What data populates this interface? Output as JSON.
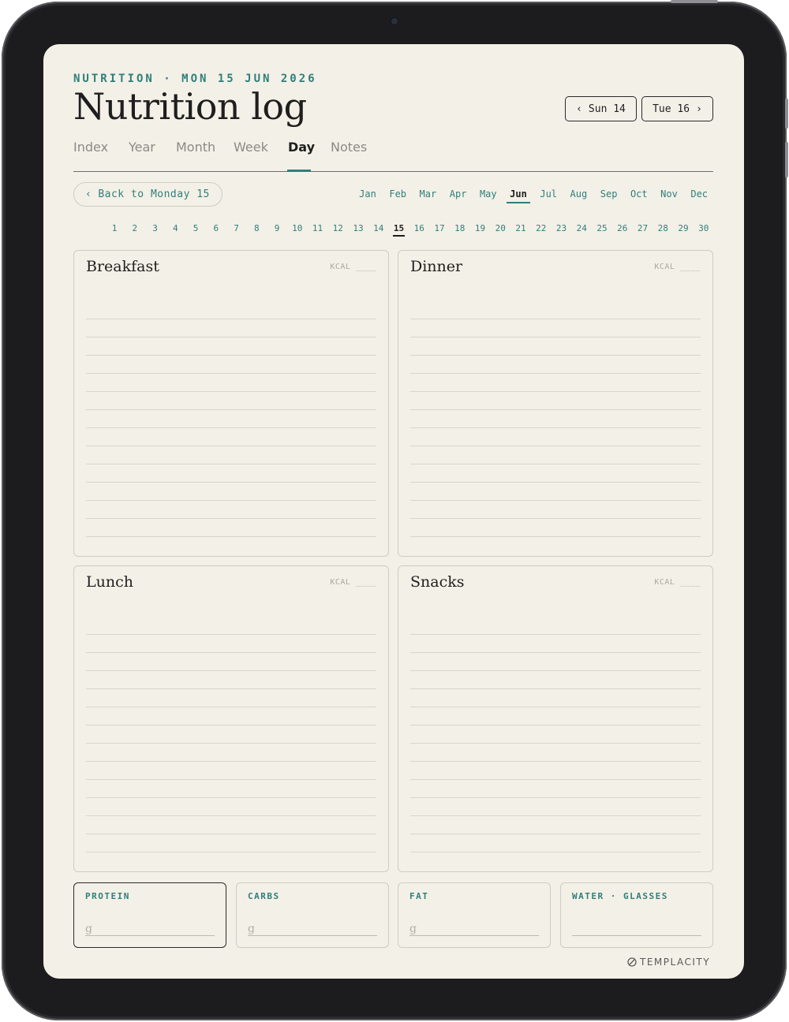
{
  "header": {
    "eyebrow": "NUTRITION · MON 15 JUN 2026",
    "title": "Nutrition log",
    "prev_day": {
      "arrow": "‹",
      "label": "Sun 14"
    },
    "next_day": {
      "label": "Tue 16",
      "arrow": "›"
    }
  },
  "tabs": [
    "Index",
    "Year",
    "Month",
    "Week",
    "Day",
    "Notes"
  ],
  "active_tab": "Day",
  "back": {
    "arrow": "‹",
    "label": "Back to Monday 15"
  },
  "months": [
    "Jan",
    "Feb",
    "Mar",
    "Apr",
    "May",
    "Jun",
    "Jul",
    "Aug",
    "Sep",
    "Oct",
    "Nov",
    "Dec"
  ],
  "active_month": "Jun",
  "days": [
    "1",
    "2",
    "3",
    "4",
    "5",
    "6",
    "7",
    "8",
    "9",
    "10",
    "11",
    "12",
    "13",
    "14",
    "15",
    "16",
    "17",
    "18",
    "19",
    "20",
    "21",
    "22",
    "23",
    "24",
    "25",
    "26",
    "27",
    "28",
    "29",
    "30"
  ],
  "active_day": "15",
  "meals": [
    {
      "title": "Breakfast",
      "kcal": "KCAL ____"
    },
    {
      "title": "Dinner",
      "kcal": "KCAL ____"
    },
    {
      "title": "Lunch",
      "kcal": "KCAL ____"
    },
    {
      "title": "Snacks",
      "kcal": "KCAL ____"
    }
  ],
  "metrics": [
    {
      "label": "PROTEIN",
      "unit": "g"
    },
    {
      "label": "CARBS",
      "unit": "g"
    },
    {
      "label": "FAT",
      "unit": "g"
    },
    {
      "label": "WATER · GLASSES",
      "unit": ""
    }
  ],
  "brand": "TEMPLACITY",
  "colors": {
    "accent": "#2f7f7a",
    "paper": "#f3f0e7",
    "bezel": "#1c1c1e"
  }
}
